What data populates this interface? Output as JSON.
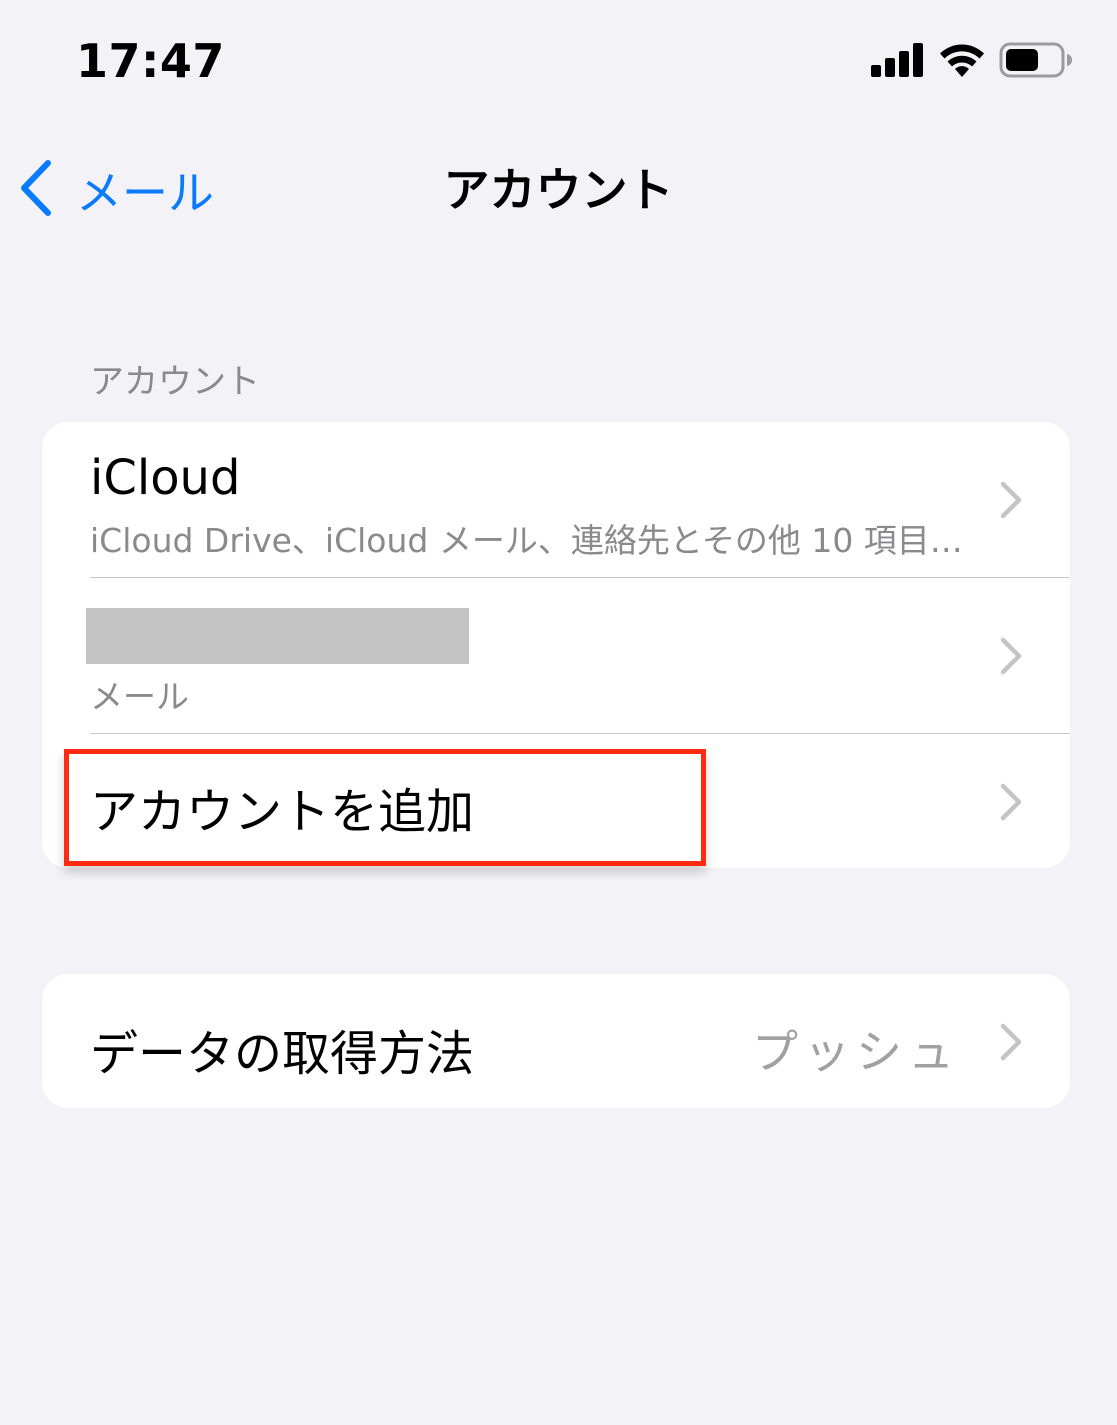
{
  "status_bar": {
    "time": "17:47",
    "icons": [
      "cellular-signal-icon",
      "wifi-icon",
      "battery-icon"
    ]
  },
  "nav": {
    "back_label": "メール",
    "title": "アカウント"
  },
  "accounts_section": {
    "header": "アカウント",
    "rows": [
      {
        "title": "iCloud",
        "subtitle": "iCloud Drive、iCloud メール、連絡先とその他 10 項目…"
      },
      {
        "title": "",
        "subtitle": "メール"
      },
      {
        "title": "アカウントを追加",
        "highlighted": true
      }
    ]
  },
  "fetch_section": {
    "label": "データの取得方法",
    "value": "プッシュ"
  },
  "colors": {
    "accent": "#0a7aff",
    "background": "#f2f2f7",
    "secondary_text": "#8a8a8e",
    "highlight": "#ff2a12"
  }
}
